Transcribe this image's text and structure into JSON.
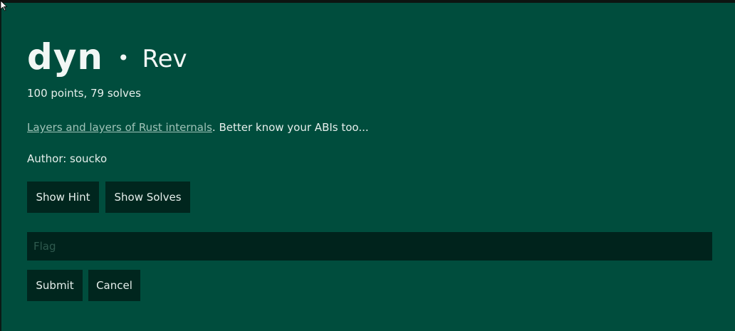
{
  "challenge": {
    "name": "dyn",
    "separator": "•",
    "category": "Rev",
    "meta": "100 points, 79 solves",
    "description_link": "Layers and layers of Rust internals",
    "description_rest": ". Better know your ABIs too...",
    "author": "Author: soucko"
  },
  "buttons": {
    "hint_label": "Show Hint",
    "solves_label": "Show Solves",
    "submit_label": "Submit",
    "cancel_label": "Cancel"
  },
  "flag_input": {
    "placeholder": "Flag",
    "value": ""
  },
  "colors": {
    "modal_bg": "#004d3d",
    "button_bg": "#00261e",
    "input_bg": "#00231c",
    "text": "#e6efec",
    "link": "#9fc3b8"
  }
}
